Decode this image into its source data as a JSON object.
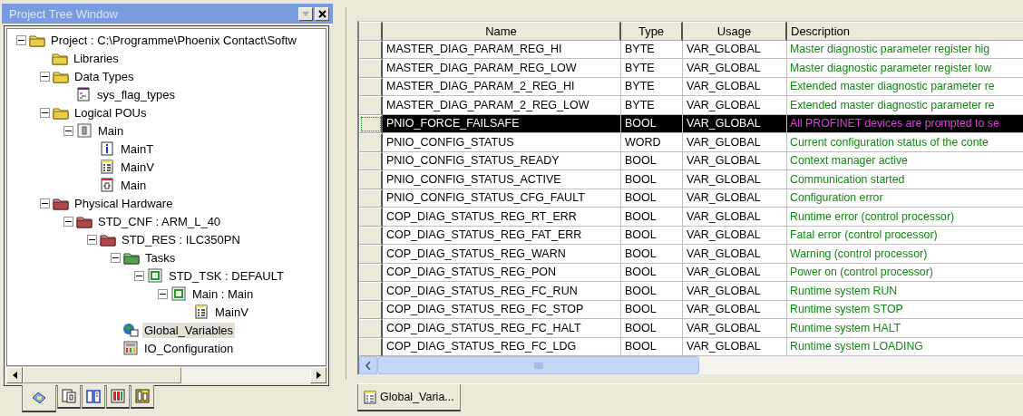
{
  "project_tree": {
    "title": "Project Tree Window",
    "nodes": [
      {
        "label": "Project : C:\\Programme\\Phoenix Contact\\Softw",
        "kind": "folder",
        "expanded": true,
        "selected": false,
        "children": [
          {
            "label": "Libraries",
            "kind": "folder",
            "selected": false
          },
          {
            "label": "Data Types",
            "kind": "folder",
            "expanded": true,
            "selected": false,
            "children": [
              {
                "label": "sys_flag_types",
                "kind": "datatype",
                "selected": false
              }
            ]
          },
          {
            "label": "Logical POUs",
            "kind": "folder",
            "expanded": true,
            "selected": false,
            "children": [
              {
                "label": "Main",
                "kind": "pou",
                "expanded": true,
                "selected": false,
                "children": [
                  {
                    "label": "MainT",
                    "kind": "info",
                    "selected": false
                  },
                  {
                    "label": "MainV",
                    "kind": "vars",
                    "selected": false
                  },
                  {
                    "label": "Main",
                    "kind": "code",
                    "selected": false
                  }
                ]
              }
            ]
          },
          {
            "label": "Physical Hardware",
            "kind": "hardware",
            "expanded": true,
            "selected": false,
            "children": [
              {
                "label": "STD_CNF : ARM_L_40",
                "kind": "hardware",
                "expanded": true,
                "selected": false,
                "children": [
                  {
                    "label": "STD_RES : ILC350PN",
                    "kind": "hardware",
                    "expanded": true,
                    "selected": false,
                    "children": [
                      {
                        "label": "Tasks",
                        "kind": "tasks",
                        "expanded": true,
                        "selected": false,
                        "children": [
                          {
                            "label": "STD_TSK : DEFAULT",
                            "kind": "task",
                            "expanded": true,
                            "selected": false,
                            "children": [
                              {
                                "label": "Main : Main",
                                "kind": "task",
                                "expanded": true,
                                "selected": false,
                                "children": [
                                  {
                                    "label": "MainV",
                                    "kind": "vars",
                                    "selected": false
                                  }
                                ]
                              }
                            ]
                          }
                        ]
                      },
                      {
                        "label": "Global_Variables",
                        "kind": "globe",
                        "selected": true
                      },
                      {
                        "label": "IO_Configuration",
                        "kind": "io",
                        "selected": false
                      }
                    ]
                  }
                ]
              }
            ]
          }
        ]
      }
    ],
    "tabs": [
      {
        "kind": "tree",
        "selected": true
      },
      {
        "kind": "pou",
        "selected": false
      },
      {
        "kind": "book",
        "selected": false
      },
      {
        "kind": "grid",
        "selected": false
      },
      {
        "kind": "io",
        "selected": false
      }
    ]
  },
  "variables_table": {
    "columns": [
      "Name",
      "Type",
      "Usage",
      "Description"
    ],
    "rows": [
      {
        "name": "MASTER_DIAG_PARAM_REG_HI",
        "type": "BYTE",
        "usage": "VAR_GLOBAL",
        "description": "Master diagnostic parameter register hig",
        "selected": false
      },
      {
        "name": "MASTER_DIAG_PARAM_REG_LOW",
        "type": "BYTE",
        "usage": "VAR_GLOBAL",
        "description": "Master diagnostic parameter register low",
        "selected": false
      },
      {
        "name": "MASTER_DIAG_PARAM_2_REG_HI",
        "type": "BYTE",
        "usage": "VAR_GLOBAL",
        "description": "Extended master diagnostic parameter re",
        "selected": false
      },
      {
        "name": "MASTER_DIAG_PARAM_2_REG_LOW",
        "type": "BYTE",
        "usage": "VAR_GLOBAL",
        "description": "Extended master diagnostic parameter re",
        "selected": false
      },
      {
        "name": "PNIO_FORCE_FAILSAFE",
        "type": "BOOL",
        "usage": "VAR_GLOBAL",
        "description": "All PROFINET devices are prompted to se",
        "selected": true
      },
      {
        "name": "PNIO_CONFIG_STATUS",
        "type": "WORD",
        "usage": "VAR_GLOBAL",
        "description": "Current configuration status of the conte",
        "selected": false
      },
      {
        "name": "PNIO_CONFIG_STATUS_READY",
        "type": "BOOL",
        "usage": "VAR_GLOBAL",
        "description": "Context manager active",
        "selected": false
      },
      {
        "name": "PNIO_CONFIG_STATUS_ACTIVE",
        "type": "BOOL",
        "usage": "VAR_GLOBAL",
        "description": "Communication started",
        "selected": false
      },
      {
        "name": "PNIO_CONFIG_STATUS_CFG_FAULT",
        "type": "BOOL",
        "usage": "VAR_GLOBAL",
        "description": "Configuration error",
        "selected": false
      },
      {
        "name": "COP_DIAG_STATUS_REG_RT_ERR",
        "type": "BOOL",
        "usage": "VAR_GLOBAL",
        "description": "Runtime error (control processor)",
        "selected": false
      },
      {
        "name": "COP_DIAG_STATUS_REG_FAT_ERR",
        "type": "BOOL",
        "usage": "VAR_GLOBAL",
        "description": "Fatal error (control processor)",
        "selected": false
      },
      {
        "name": "COP_DIAG_STATUS_REG_WARN",
        "type": "BOOL",
        "usage": "VAR_GLOBAL",
        "description": "Warning (control processor)",
        "selected": false
      },
      {
        "name": "COP_DIAG_STATUS_REG_PON",
        "type": "BOOL",
        "usage": "VAR_GLOBAL",
        "description": "Power on (control processor)",
        "selected": false
      },
      {
        "name": "COP_DIAG_STATUS_REG_FC_RUN",
        "type": "BOOL",
        "usage": "VAR_GLOBAL",
        "description": "Runtime system RUN",
        "selected": false
      },
      {
        "name": "COP_DIAG_STATUS_REG_FC_STOP",
        "type": "BOOL",
        "usage": "VAR_GLOBAL",
        "description": "Runtime system STOP",
        "selected": false
      },
      {
        "name": "COP_DIAG_STATUS_REG_FC_HALT",
        "type": "BOOL",
        "usage": "VAR_GLOBAL",
        "description": "Runtime system HALT",
        "selected": false
      },
      {
        "name": "COP_DIAG_STATUS_REG_FC_LDG",
        "type": "BOOL",
        "usage": "VAR_GLOBAL",
        "description": "Runtime system LOADING",
        "selected": false
      }
    ]
  },
  "document_tabs": [
    {
      "label": "Global_Varia...",
      "selected": true
    }
  ]
}
